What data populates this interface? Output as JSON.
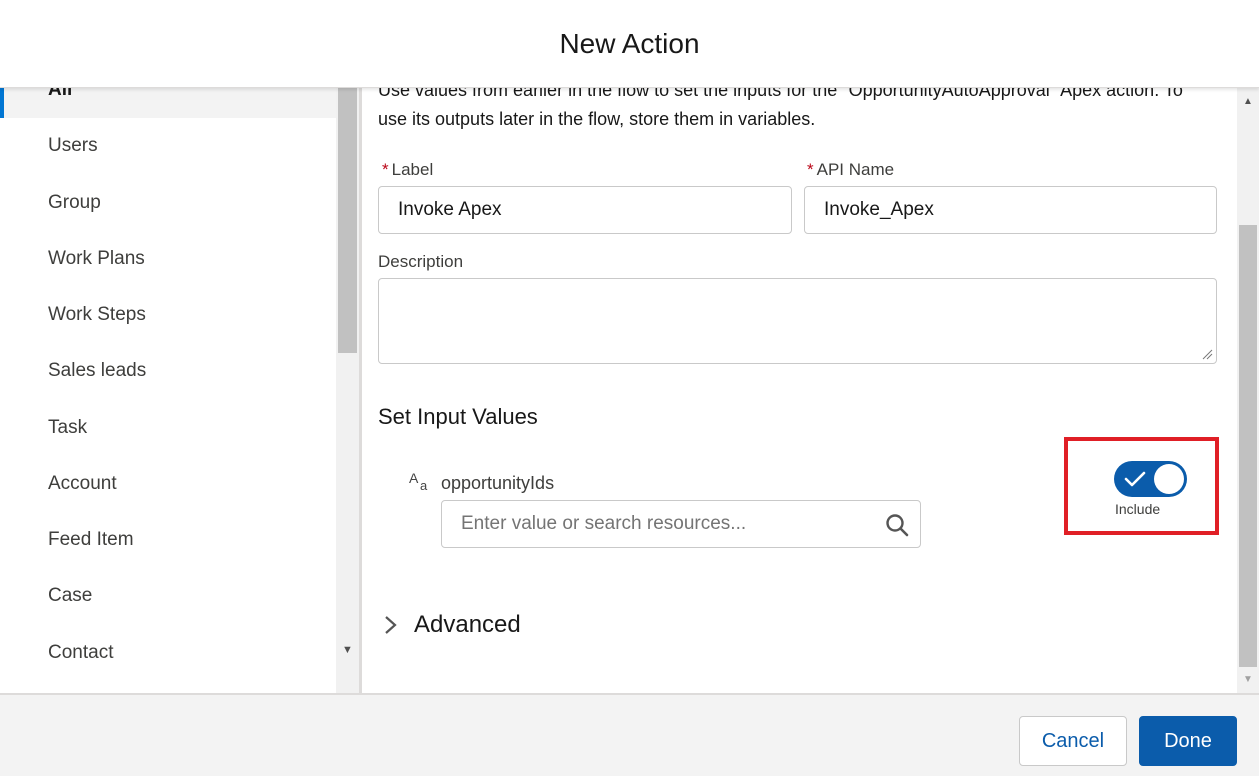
{
  "modal": {
    "title": "New Action"
  },
  "sidebar": {
    "items": [
      {
        "label": "All",
        "selected": true
      },
      {
        "label": "Users"
      },
      {
        "label": "Group"
      },
      {
        "label": "Work Plans"
      },
      {
        "label": "Work Steps"
      },
      {
        "label": "Sales leads"
      },
      {
        "label": "Task"
      },
      {
        "label": "Account"
      },
      {
        "label": "Feed Item"
      },
      {
        "label": "Case"
      },
      {
        "label": "Contact"
      }
    ]
  },
  "main": {
    "intro": "Use values from earlier in the flow to set the inputs for the \"OpportunityAutoApproval\" Apex action. To use its outputs later in the flow, store them in variables.",
    "label_field": {
      "label": "Label",
      "value": "Invoke Apex",
      "required_mark": "*"
    },
    "api_name_field": {
      "label": "API Name",
      "value": "Invoke_Apex",
      "required_mark": "*"
    },
    "description_field": {
      "label": "Description",
      "value": ""
    },
    "input_section": {
      "title": "Set Input Values",
      "param_label": "opportunityIds",
      "param_icon": "text-type-icon",
      "search_placeholder": "Enter value or search resources...",
      "toggle_label": "Include",
      "toggle_on": true,
      "highlight_color": "#e01f26"
    },
    "advanced_label": "Advanced"
  },
  "footer": {
    "cancel_label": "Cancel",
    "done_label": "Done"
  },
  "colors": {
    "brand": "#0b5cab",
    "selected_accent": "#0176d3",
    "required": "#ba0517"
  }
}
